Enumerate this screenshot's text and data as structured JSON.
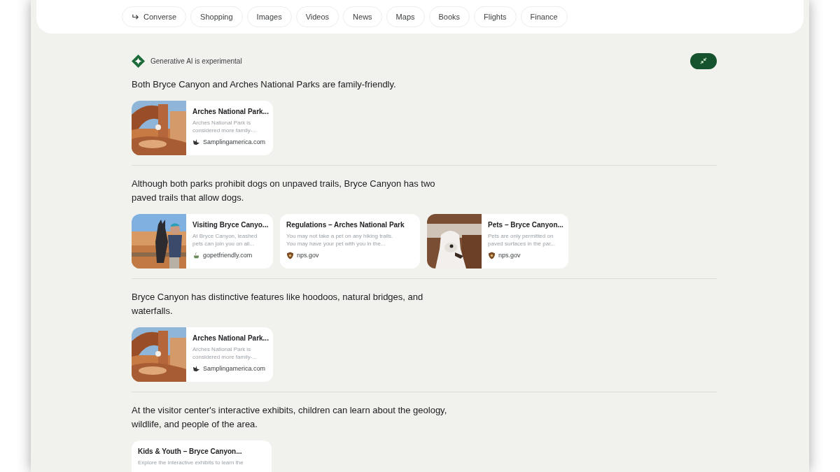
{
  "chips": [
    {
      "label": "Converse",
      "kind": "converse"
    },
    {
      "label": "Shopping",
      "kind": "plain"
    },
    {
      "label": "Images",
      "kind": "plain"
    },
    {
      "label": "Videos",
      "kind": "plain"
    },
    {
      "label": "News",
      "kind": "plain"
    },
    {
      "label": "Maps",
      "kind": "plain"
    },
    {
      "label": "Books",
      "kind": "plain"
    },
    {
      "label": "Flights",
      "kind": "plain"
    },
    {
      "label": "Finance",
      "kind": "plain"
    }
  ],
  "ai_banner": {
    "label": "Generative AI is experimental"
  },
  "sections": [
    {
      "text": "Both Bryce Canyon and Arches National Parks are family-friendly.",
      "cards": [
        {
          "kind": "picture",
          "title": "Arches National Park...",
          "snippet": [
            "Arches National Park is",
            "considered more family-..."
          ],
          "source": "Samplingamerica.com"
        }
      ]
    },
    {
      "text": "Although both parks prohibit dogs on unpaved trails, Bryce Canyon has two paved trails that allow dogs.",
      "cards": [
        {
          "kind": "picture",
          "title": "Visiting Bryce Canyo...",
          "snippet": [
            "At Bryce Canyon, leashed",
            "pets can join you on all..."
          ],
          "source": "gopetfriendly.com"
        },
        {
          "kind": "text",
          "title": "Regulations – Arches National Park",
          "snippet": [
            "You may not take a pet on any hiking trails.",
            "You may have your pet with you in the..."
          ],
          "source": "nps.gov"
        },
        {
          "kind": "picture",
          "title": "Pets – Bryce Canyon...",
          "snippet": [
            "Pets are only permitted on",
            "paved surfaces in the par..."
          ],
          "source": "nps.gov"
        }
      ]
    },
    {
      "text": "Bryce Canyon has distinctive features like hoodoos, natural bridges, and waterfalls.",
      "cards": [
        {
          "kind": "picture",
          "title": "Arches National Park...",
          "snippet": [
            "Arches National Park is",
            "considered more family-..."
          ],
          "source": "Samplingamerica.com"
        }
      ]
    },
    {
      "text": "At the visitor center's interactive exhibits, children can learn about the geology, wildlife, and people of the area.",
      "cards": [
        {
          "kind": "text",
          "title": "Kids & Youth – Bryce Canyon...",
          "snippet": [
            "Explore the interactive exhibits to learn the"
          ]
        }
      ]
    }
  ]
}
